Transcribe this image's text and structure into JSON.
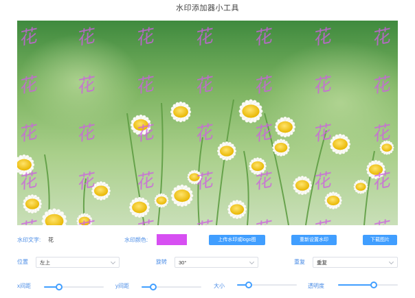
{
  "app_title": "水印添加器小工具",
  "watermark_glyph": "花",
  "watermark_color": "#d74ff2",
  "controls": {
    "text_label": "水印文字:",
    "text_value": "花",
    "color_label": "水印颜色:",
    "upload_button": "上传水印或logo图",
    "reset_button": "重新设置水印",
    "download_button": "下载图片",
    "position_label": "位置",
    "position_value": "左上",
    "rotate_label": "旋转",
    "rotate_value": "30°",
    "repeat_label": "重复",
    "repeat_value": "重复",
    "x_gap_label": "x间距",
    "x_gap_level": 0.25,
    "y_gap_label": "y间距",
    "y_gap_level": 0.2,
    "size_label": "大小",
    "size_level": 0.2,
    "opacity_label": "透明度",
    "opacity_level": 0.6
  },
  "accent_color": "#409eff"
}
